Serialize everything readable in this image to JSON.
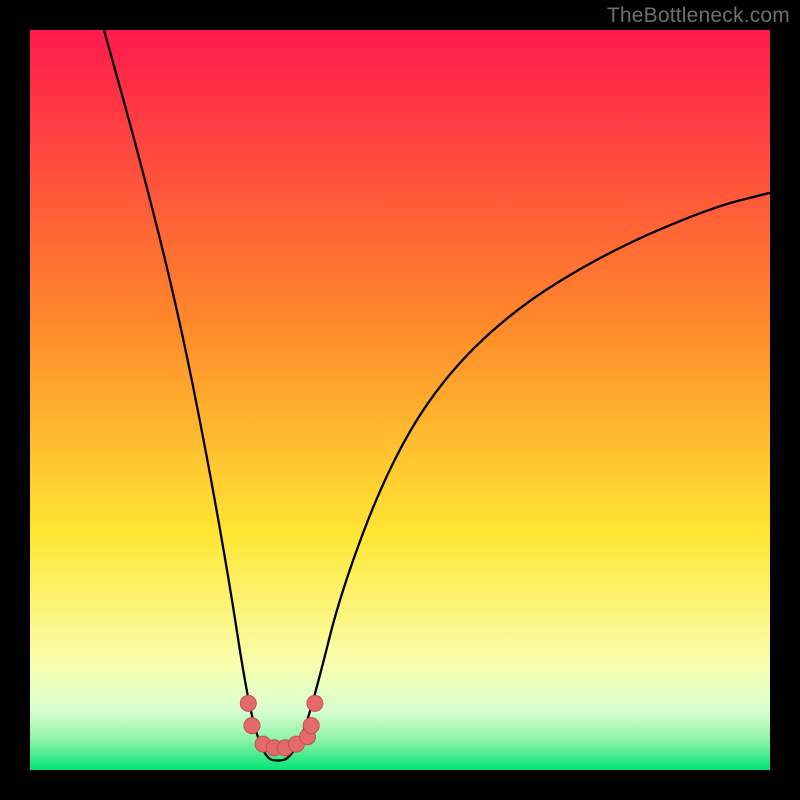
{
  "watermark": "TheBottleneck.com",
  "colors": {
    "frame_bg": "#000000",
    "gradient_top": "#ff1a4d",
    "gradient_mid1": "#ff8a2a",
    "gradient_mid2": "#ffe633",
    "gradient_mid3": "#f8ffb0",
    "gradient_bottom": "#00e676",
    "curve": "#000000",
    "marker_fill": "#e46a6a",
    "marker_stroke": "#c24f4f"
  },
  "chart_data": {
    "type": "line",
    "title": "",
    "xlabel": "",
    "ylabel": "",
    "xlim": [
      0,
      100
    ],
    "ylim": [
      0,
      100
    ],
    "grid": false,
    "legend": false,
    "annotations": [
      "TheBottleneck.com"
    ],
    "series": [
      {
        "name": "bottleneck-curve",
        "x": [
          10,
          15,
          20,
          24,
          27,
          29,
          30.5,
          32,
          33.5,
          35,
          37,
          39,
          42,
          48,
          55,
          65,
          78,
          92,
          100
        ],
        "values": [
          100,
          82,
          62,
          42,
          25,
          12,
          5,
          1.5,
          1.2,
          1.5,
          5,
          12,
          24,
          40,
          52,
          62,
          70,
          76,
          78
        ]
      },
      {
        "name": "marker-dots",
        "x": [
          29.5,
          30,
          31.5,
          33,
          34.5,
          36,
          37.5,
          38,
          38.5
        ],
        "values": [
          9,
          6,
          3.5,
          3,
          3,
          3.5,
          4.5,
          6,
          9
        ]
      }
    ]
  }
}
